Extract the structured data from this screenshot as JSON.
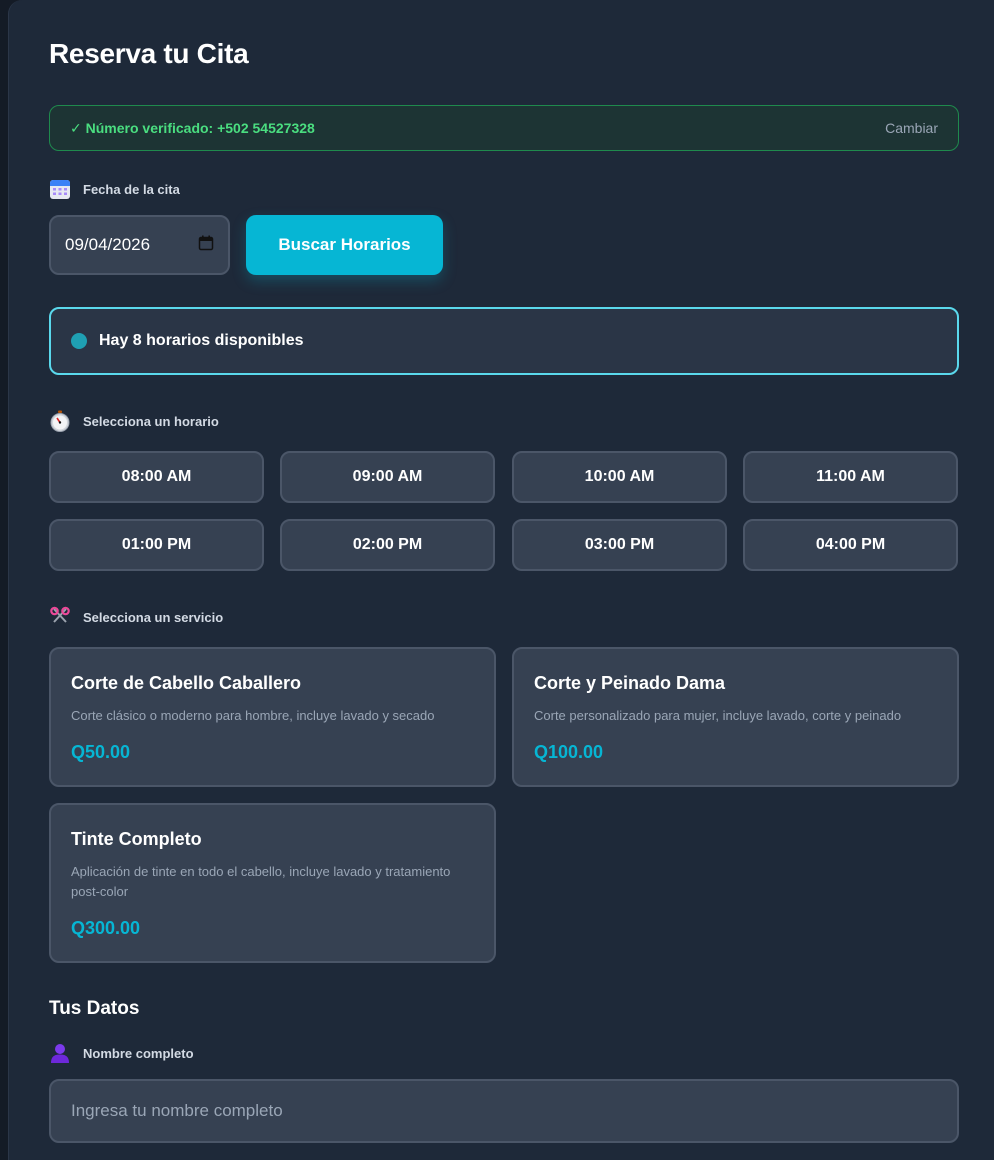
{
  "page": {
    "title": "Reserva tu Cita"
  },
  "verification": {
    "text": "✓ Número verificado: +502 54527328",
    "change_label": "Cambiar"
  },
  "date_section": {
    "label": "Fecha de la cita",
    "icon": "calendar-icon",
    "value": "09/04/2026",
    "search_button": "Buscar Horarios"
  },
  "availability": {
    "text": "Hay 8 horarios disponibles"
  },
  "time_section": {
    "label": "Selecciona un horario",
    "icon": "stopwatch-icon",
    "slots": [
      "08:00 AM",
      "09:00 AM",
      "10:00 AM",
      "11:00 AM",
      "01:00 PM",
      "02:00 PM",
      "03:00 PM",
      "04:00 PM"
    ]
  },
  "service_section": {
    "label": "Selecciona un servicio",
    "icon": "scissors-icon",
    "services": [
      {
        "name": "Corte de Cabello Caballero",
        "description": "Corte clásico o moderno para hombre, incluye lavado y secado",
        "price": "Q50.00"
      },
      {
        "name": "Corte y Peinado Dama",
        "description": "Corte personalizado para mujer, incluye lavado, corte y peinado",
        "price": "Q100.00"
      },
      {
        "name": "Tinte Completo",
        "description": "Aplicación de tinte en todo el cabello, incluye lavado y tratamiento post-color",
        "price": "Q300.00"
      }
    ]
  },
  "user_section": {
    "title": "Tus Datos",
    "name_label": "Nombre completo",
    "name_icon": "person-icon",
    "name_placeholder": "Ingresa tu nombre completo"
  },
  "colors": {
    "accent": "#06b6d4",
    "success": "#4ade80",
    "background": "#1e2939",
    "surface": "#364152"
  }
}
